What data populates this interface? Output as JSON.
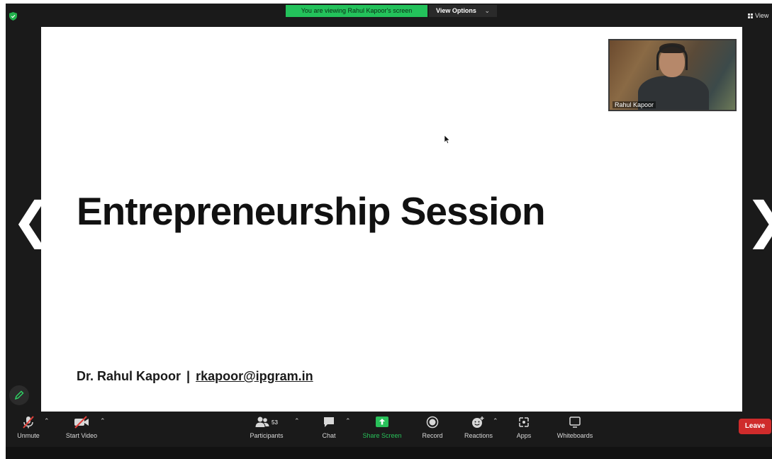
{
  "topbar": {
    "banner": "You are viewing Rahul Kapoor's screen",
    "view_options": "View Options",
    "view": "View"
  },
  "slide": {
    "title": "Entrepreneurship Session",
    "presenter": "Dr. Rahul Kapoor",
    "separator": "|",
    "email": "rkapoor@ipgram.in"
  },
  "thumbnail": {
    "name": "Rahul Kapoor"
  },
  "navigation": {
    "prev": "❮",
    "next": "❯"
  },
  "toolbar": {
    "unmute": "Unmute",
    "start_video": "Start Video",
    "participants": "Participants",
    "participants_count": "53",
    "chat": "Chat",
    "share_screen": "Share Screen",
    "record": "Record",
    "reactions": "Reactions",
    "apps": "Apps",
    "whiteboards": "Whiteboards",
    "leave": "Leave"
  },
  "colors": {
    "banner_green": "#23c25b",
    "leave_red": "#cf2b2b",
    "share_green": "#29c15a"
  }
}
